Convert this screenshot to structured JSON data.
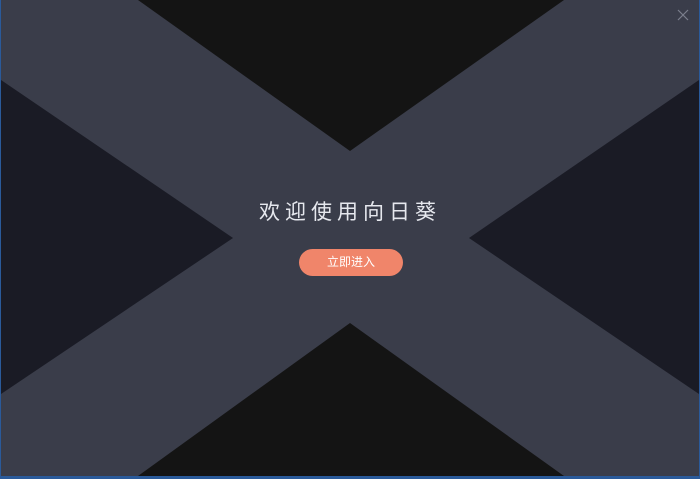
{
  "window": {
    "close_icon": "close-icon"
  },
  "welcome": {
    "title": "欢迎使用向日葵",
    "enter_label": "立即进入"
  },
  "colors": {
    "band": "#3a3d4a",
    "top_bottom_triangles": "#141414",
    "side_triangles": "#1a1b25",
    "accent": "#f0856a",
    "frame": "#2a5a9a",
    "title_text": "#e6e8ee"
  }
}
